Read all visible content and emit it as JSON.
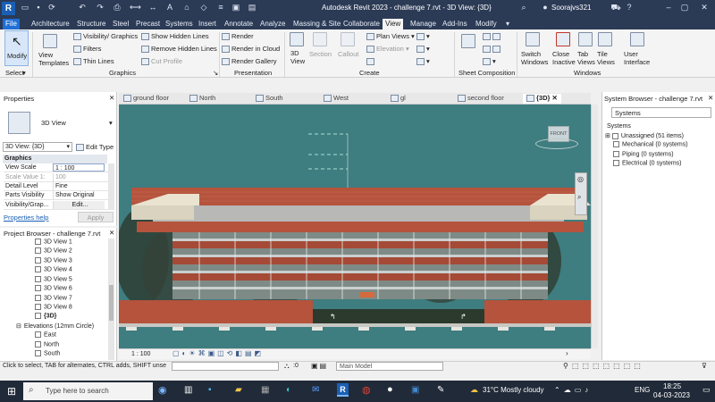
{
  "app": {
    "title": "Autodesk Revit 2023 - challenge 7.rvt - 3D View: {3D}",
    "user": "Soorajvs321"
  },
  "menu": {
    "file": "File",
    "tabs": [
      "Architecture",
      "Structure",
      "Steel",
      "Precast",
      "Systems",
      "Insert",
      "Annotate",
      "Analyze",
      "Massing & Site",
      "Collaborate",
      "View",
      "Manage",
      "Add-Ins",
      "Modify"
    ],
    "active": "View"
  },
  "ribbon": {
    "modify": "Modify",
    "select": "Select",
    "graphics": {
      "view_templates": "View Templates",
      "visibility_graphics": "Visibility/ Graphics",
      "filters": "Filters",
      "thin_lines": "Thin Lines",
      "show_hidden_lines": "Show Hidden Lines",
      "remove_hidden_lines": "Remove Hidden Lines",
      "cut_profile": "Cut Profile",
      "label": "Graphics"
    },
    "presentation": {
      "render": "Render",
      "render_cloud": "Render in Cloud",
      "render_gallery": "Render Gallery",
      "label": "Presentation"
    },
    "create": {
      "view_3d": "3D View",
      "section": "Section",
      "callout": "Callout",
      "plan_views": "Plan Views",
      "elevation": "Elevation",
      "label": "Create"
    },
    "sheet_composition": {
      "label": "Sheet Composition"
    },
    "windows": {
      "switch_windows": "Switch Windows",
      "close_inactive": "Close Inactive",
      "tab_views": "Tab Views",
      "tile_views": "Tile Views",
      "user_interface": "User Interface",
      "label": "Windows"
    }
  },
  "properties": {
    "title": "Properties",
    "type_name": "3D View",
    "selector": "3D View: {3D}",
    "edit_type": "Edit Type",
    "section": "Graphics",
    "rows": [
      {
        "key": "View Scale",
        "value": "1 : 100"
      },
      {
        "key": "Scale Value  1:",
        "value": "100"
      },
      {
        "key": "Detail Level",
        "value": "Fine"
      },
      {
        "key": "Parts Visibility",
        "value": "Show Original"
      },
      {
        "key": "Visibility/Grap...",
        "value": "Edit..."
      }
    ],
    "help": "Properties help",
    "apply": "Apply"
  },
  "project_browser": {
    "title": "Project Browser - challenge 7.rvt",
    "items": [
      "3D View 1",
      "3D View 2",
      "3D View 3",
      "3D View 4",
      "3D View 5",
      "3D View 6",
      "3D View 7",
      "3D View 8",
      "{3D}"
    ],
    "elevations_group": "Elevations (12mm Circle)",
    "elevations": [
      "East",
      "North",
      "South"
    ]
  },
  "view_tabs": [
    "ground floor",
    "North",
    "South",
    "West",
    "gl",
    "second floor",
    "{3D}"
  ],
  "system_browser": {
    "title": "System Browser - challenge 7.rvt",
    "dropdown": "Systems",
    "header": "Systems",
    "items": [
      "Unassigned (51 items)",
      "Mechanical (0 systems)",
      "Piping (0 systems)",
      "Electrical (0 systems)"
    ]
  },
  "canvas": {
    "viewcube_label": "FRONT",
    "scale": "1 : 100"
  },
  "status": {
    "hint": "Click to select, TAB for alternates, CTRL adds, SHIFT unse",
    "zero": ":0",
    "model": "Main Model"
  },
  "taskbar": {
    "search": "Type here to search",
    "weather": "31°C  Mostly cloudy",
    "lang": "ENG",
    "time": "18:25",
    "date": "04-03-2023"
  },
  "colors": {
    "title_bg": "#2b3a55",
    "canvas_bg": "#3e7d80",
    "brick": "#b5533c",
    "accent": "#1f6fd6"
  }
}
